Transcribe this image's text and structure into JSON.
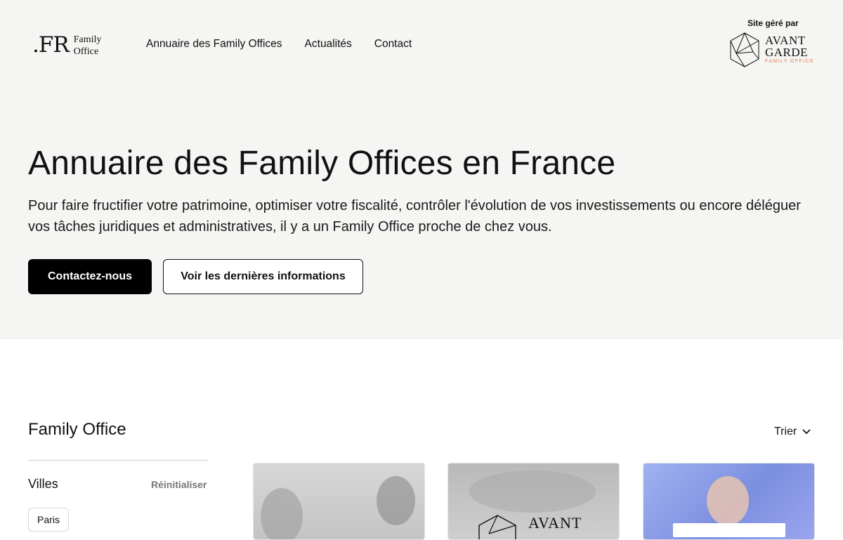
{
  "header": {
    "logo": {
      "mark": ".FR",
      "line1": "Family",
      "line2": "Office"
    },
    "nav": [
      {
        "label": "Annuaire des Family Offices"
      },
      {
        "label": "Actualités"
      },
      {
        "label": "Contact"
      }
    ],
    "managed_by": {
      "label": "Site géré par",
      "brand_line1": "AVANT",
      "brand_line2": "GARDE",
      "brand_sub": "FAMILY OFFICE"
    }
  },
  "hero": {
    "title": "Annuaire des Family Offices en France",
    "description": "Pour faire fructifier votre patrimoine, optimiser votre fiscalité, contrôler l'évolution de vos investissements ou encore déléguer vos tâches juridiques et administratives, il y a un Family Office proche de chez vous.",
    "primary_button": "Contactez-nous",
    "secondary_button": "Voir les dernières informations"
  },
  "listing": {
    "title": "Family Office",
    "sort_label": "Trier",
    "filters": {
      "title": "Villes",
      "reset_label": "Réinitialiser",
      "chips": [
        "Paris"
      ]
    },
    "cards": [
      {
        "icon": "team-photo-image"
      },
      {
        "icon": "avant-garde-logo-image",
        "text": "AVANT"
      },
      {
        "icon": "speaker-photo-image"
      }
    ]
  },
  "colors": {
    "hero_background": "#f5f5f3",
    "primary_button": "#000000",
    "accent_orange": "#e27a4e"
  }
}
